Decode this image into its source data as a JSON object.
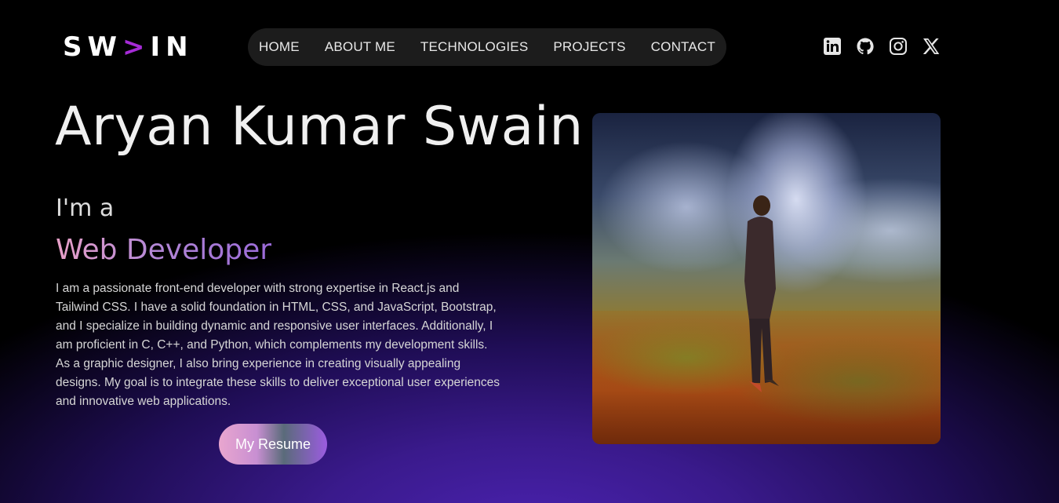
{
  "logo": {
    "part1": "SW",
    "arrow": ">",
    "part2": "IN"
  },
  "nav": {
    "items": [
      {
        "label": "HOME"
      },
      {
        "label": "ABOUT ME"
      },
      {
        "label": "TECHNOLOGIES"
      },
      {
        "label": "PROJECTS"
      },
      {
        "label": "CONTACT"
      }
    ]
  },
  "socials": {
    "items": [
      {
        "icon": "linkedin-icon"
      },
      {
        "icon": "github-icon"
      },
      {
        "icon": "instagram-icon"
      },
      {
        "icon": "x-icon"
      }
    ]
  },
  "hero": {
    "name": "Aryan Kumar Swain",
    "intro": "I'm a",
    "role": "Web Developer",
    "bio": "I am a passionate front-end developer with strong expertise in React.js and Tailwind CSS. I have a solid foundation in HTML, CSS, and JavaScript, Bootstrap, and I specialize in building dynamic and responsive user interfaces. Additionally, I am proficient in C, C++, and Python, which complements my development skills. As a graphic designer, I also bring experience in creating visually appealing designs. My goal is to integrate these skills to deliver exceptional user experiences and innovative web applications.",
    "resume_button": "My Resume"
  },
  "colors": {
    "background": "#000000",
    "glow": "#4a22b0",
    "accent": "#a52bd6",
    "nav_bg": "#1c1c1c"
  }
}
